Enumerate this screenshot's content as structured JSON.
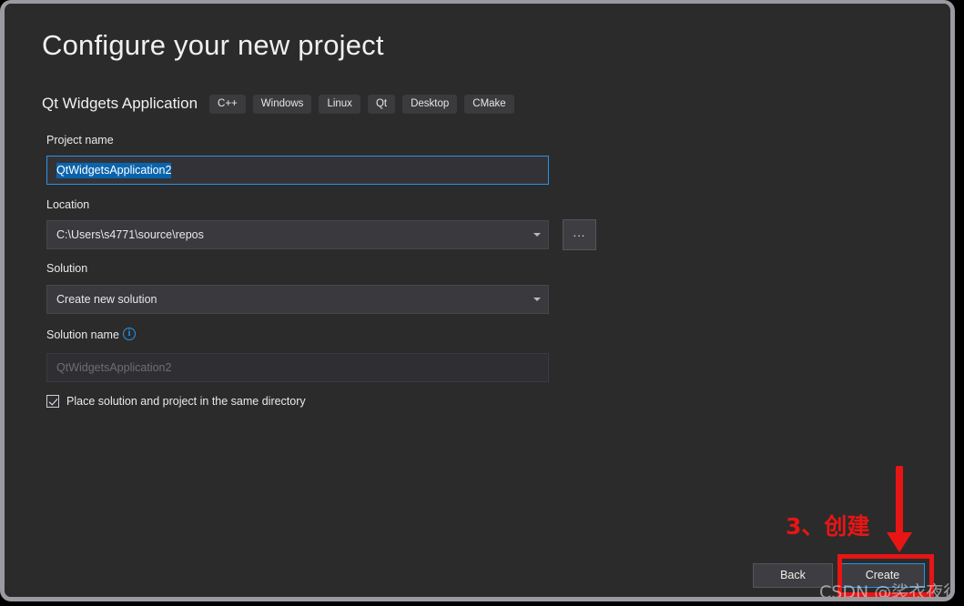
{
  "dialog": {
    "title": "Configure your new project",
    "template_name": "Qt Widgets Application",
    "tags": [
      "C++",
      "Windows",
      "Linux",
      "Qt",
      "Desktop",
      "CMake"
    ]
  },
  "form": {
    "project_name": {
      "label": "Project name",
      "value": "QtWidgetsApplication2"
    },
    "location": {
      "label": "Location",
      "value": "C:\\Users\\s4771\\source\\repos",
      "browse_label": "..."
    },
    "solution": {
      "label": "Solution",
      "value": "Create new solution"
    },
    "solution_name": {
      "label": "Solution name",
      "info_glyph": "i",
      "placeholder": "QtWidgetsApplication2",
      "value": ""
    },
    "same_directory": {
      "label": "Place solution and project in the same directory",
      "checked": true
    }
  },
  "footer": {
    "back_label": "Back",
    "create_label": "Create"
  },
  "annotations": {
    "step_text": "3、创建",
    "watermark": "CSDN @裟衣夜行"
  },
  "colors": {
    "accent_blue": "#2b92e4",
    "selection_blue": "#0a64ad",
    "annotation_red": "#e81515",
    "dialog_bg": "#2b2b2b",
    "frame_border": "#9a9aa0"
  }
}
